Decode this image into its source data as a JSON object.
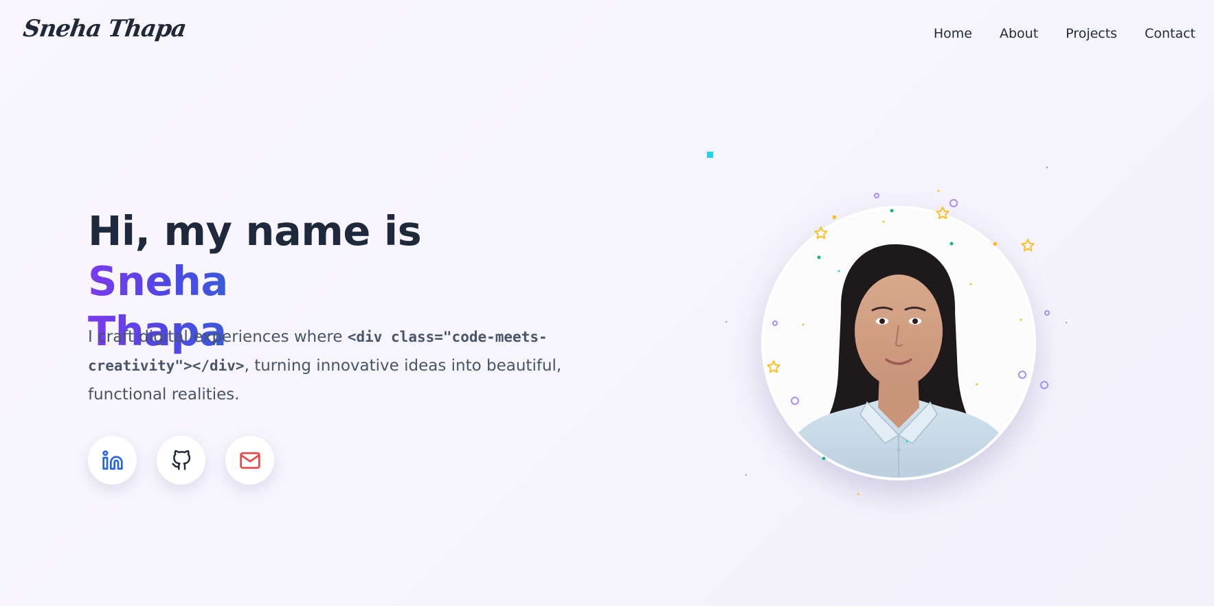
{
  "header": {
    "logo_text": "Sneha Thapa",
    "nav": [
      {
        "label": "Home"
      },
      {
        "label": "About"
      },
      {
        "label": "Projects"
      },
      {
        "label": "Contact"
      }
    ]
  },
  "hero": {
    "title_prefix": "Hi, my name is ",
    "title_name_first": "Sneha",
    "title_name_last": "Thapa",
    "description_before": "I craft digital experiences where ",
    "description_code": "<div class=\"code-meets-creativity\"></div>",
    "description_after": ", turning innovative ideas into beautiful, functional realities."
  },
  "social_links": [
    {
      "name": "LinkedIn",
      "icon": "linkedin-icon",
      "color": "#2563eb"
    },
    {
      "name": "GitHub",
      "icon": "github-icon",
      "color": "#1f2937"
    },
    {
      "name": "Email",
      "icon": "mail-icon",
      "color": "#ef4444"
    }
  ],
  "colors": {
    "accent_purple": "#7c3aed",
    "accent_indigo": "#4f46e5",
    "accent_blue": "#3b5bdb",
    "text_dark": "#1e293b",
    "text_muted": "#475569",
    "confetti_yellow": "#fbbf24",
    "confetti_violet": "#a78bfa",
    "confetti_green": "#10b981",
    "confetti_cyan": "#22d3ee"
  }
}
